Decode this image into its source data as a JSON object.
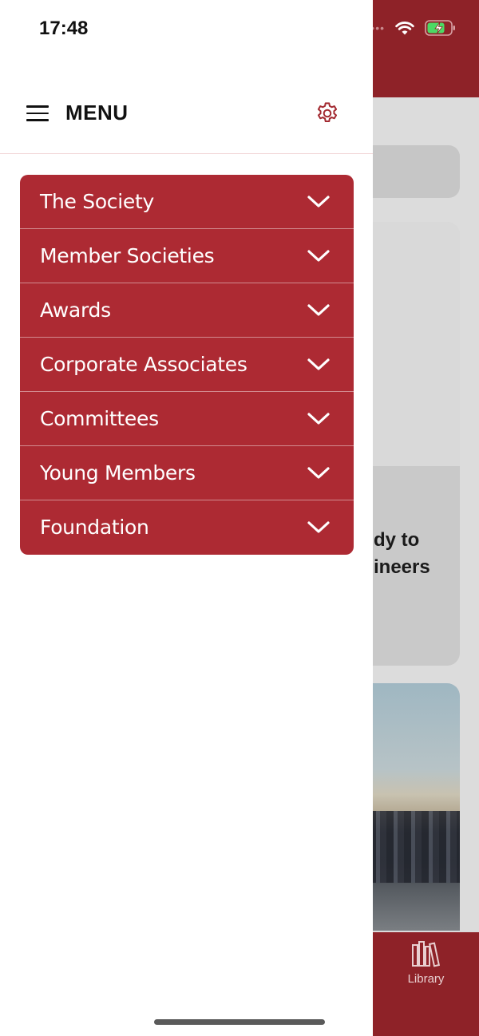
{
  "status_bar": {
    "time": "17:48"
  },
  "drawer": {
    "title": "MENU",
    "menu_icon": "hamburger-icon",
    "settings_icon": "gear-icon",
    "items": [
      {
        "label": "The Society"
      },
      {
        "label": "Member Societies"
      },
      {
        "label": "Awards"
      },
      {
        "label": "Corporate Associates"
      },
      {
        "label": "Committees"
      },
      {
        "label": "Young Members"
      },
      {
        "label": "Foundation"
      }
    ]
  },
  "background": {
    "card_text": "dy to\nineers",
    "tab_library_label": "Library"
  },
  "colors": {
    "brand_red": "#8e2228",
    "accordion_red": "#ad2a33"
  }
}
